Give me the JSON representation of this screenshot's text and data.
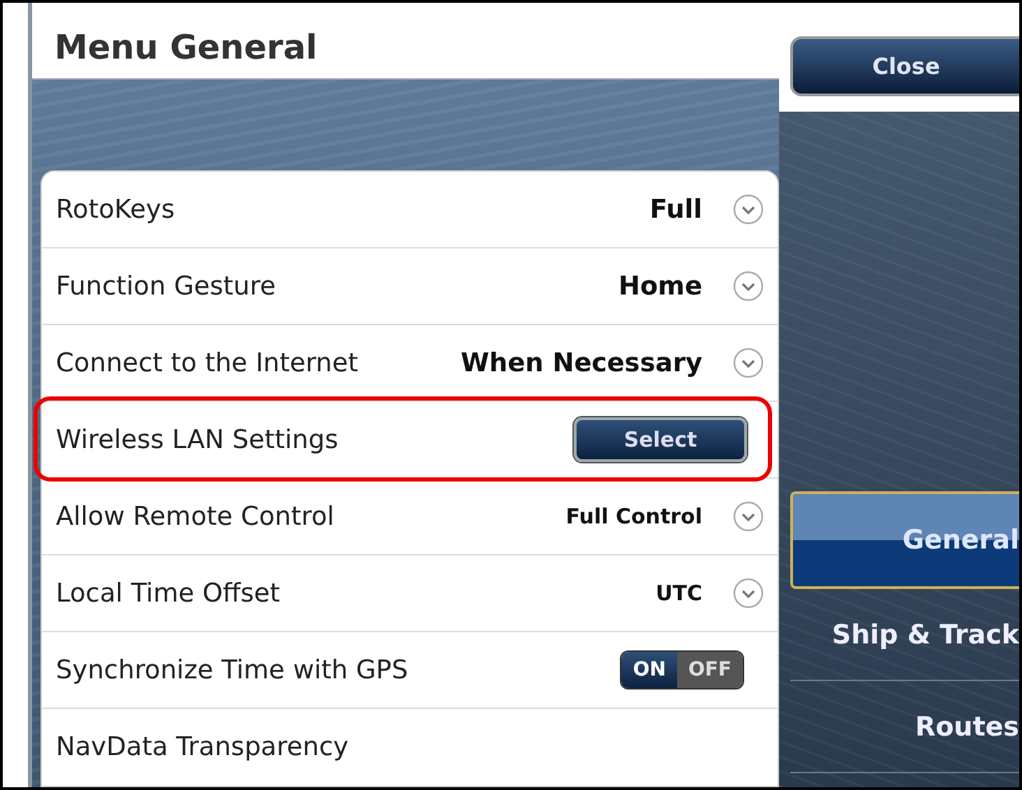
{
  "window": {
    "title": "Menu General"
  },
  "close_button": {
    "label": "Close"
  },
  "settings": [
    {
      "kind": "dropdown",
      "label": "RotoKeys",
      "value": "Full",
      "highlighted": false
    },
    {
      "kind": "dropdown",
      "label": "Function Gesture",
      "value": "Home",
      "highlighted": false
    },
    {
      "kind": "dropdown",
      "label": "Connect to the Internet",
      "value": "When Necessary",
      "highlighted": false
    },
    {
      "kind": "button",
      "label": "Wireless LAN Settings",
      "button": "Select",
      "highlighted": true
    },
    {
      "kind": "dropdown",
      "label": "Allow Remote Control",
      "value": "Full Control",
      "small": true,
      "highlighted": false
    },
    {
      "kind": "dropdown",
      "label": "Local Time Offset",
      "value": "UTC",
      "small": true,
      "highlighted": false
    },
    {
      "kind": "toggle",
      "label": "Synchronize Time with GPS",
      "on": true,
      "on_label": "ON",
      "off_label": "OFF",
      "highlighted": false
    },
    {
      "kind": "plain",
      "label": "NavData Transparency",
      "highlighted": false
    }
  ],
  "sidebar": {
    "items": [
      {
        "label": "General",
        "selected": true
      },
      {
        "label": "Ship & Track",
        "selected": false
      },
      {
        "label": "Routes",
        "selected": false
      }
    ]
  }
}
